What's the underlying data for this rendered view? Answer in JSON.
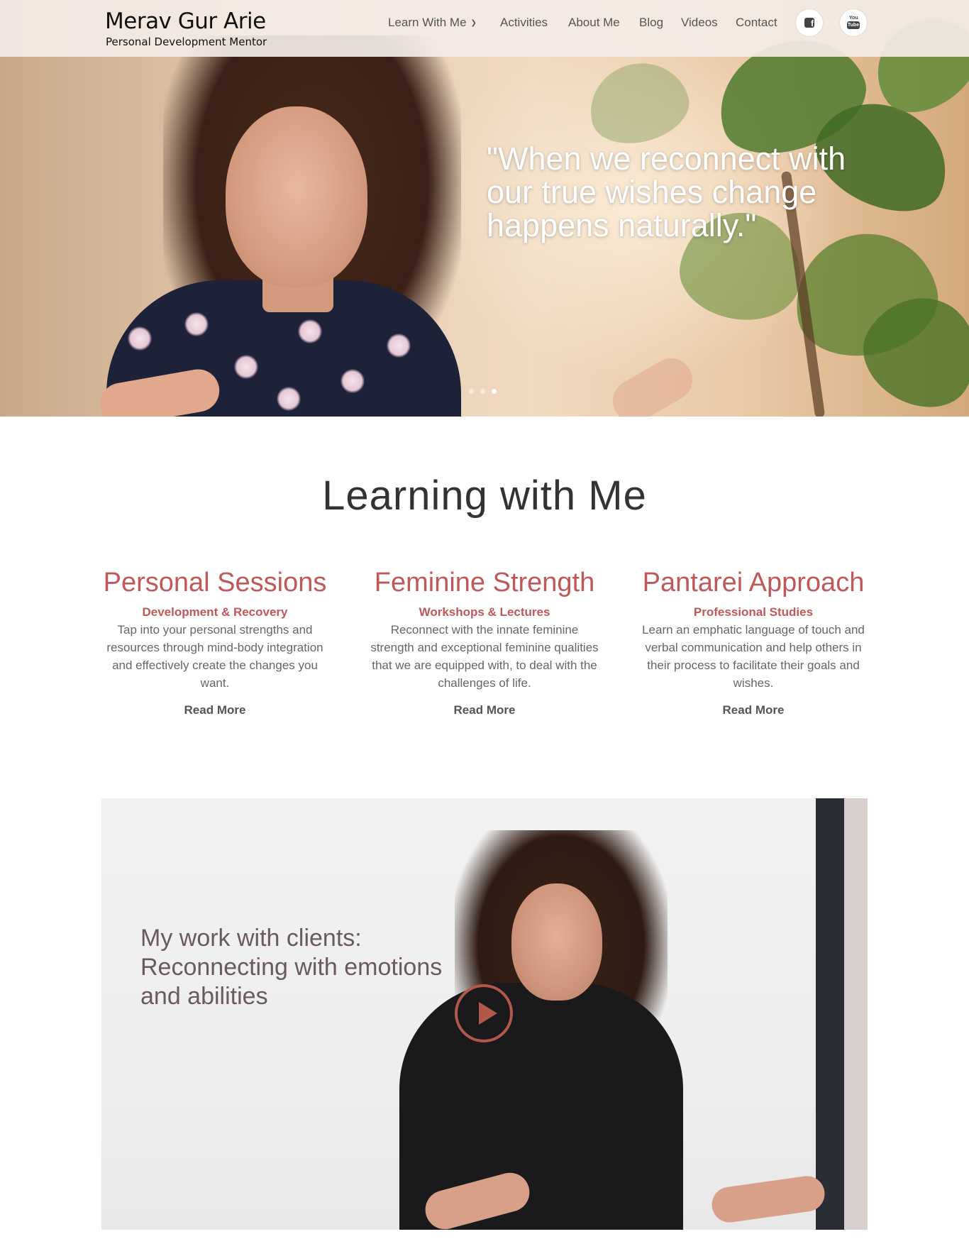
{
  "header": {
    "title": "Merav Gur Arie",
    "subtitle": "Personal Development Mentor",
    "nav": [
      {
        "label": "Learn With Me",
        "has_dropdown": true
      },
      {
        "label": "Activities"
      },
      {
        "label": "About Me"
      },
      {
        "label": "Blog"
      },
      {
        "label": "Videos"
      },
      {
        "label": "Contact"
      }
    ],
    "social": [
      {
        "icon": "facebook-icon",
        "glyph": "f"
      },
      {
        "icon": "youtube-icon",
        "top": "You",
        "bottom": "Tube"
      }
    ]
  },
  "hero": {
    "quote": "\"When we reconnect with our true wishes change happens naturally.\"",
    "slides_count": 3,
    "active_slide": 3
  },
  "learning": {
    "title": "Learning with Me",
    "cards": [
      {
        "title": "Personal Sessions",
        "subtitle": "Development & Recovery",
        "text": "Tap into your personal strengths and resources through mind-body integration and effectively create the changes you want.",
        "link": "Read More"
      },
      {
        "title": "Feminine Strength",
        "subtitle": "Workshops & Lectures",
        "text": "Reconnect with the innate feminine strength and exceptional feminine qualities that we are equipped with, to deal with the challenges of life.",
        "link": "Read More"
      },
      {
        "title": "Pantarei Approach",
        "subtitle": "Professional Studies",
        "text": "Learn an emphatic language of touch and verbal communication and help others in their process to facilitate their goals and wishes.",
        "link": "Read More"
      }
    ]
  },
  "video": {
    "caption": "My work with clients: Reconnecting with emotions and abilities"
  },
  "colors": {
    "accent": "#c0585a",
    "play_button": "#b2584a",
    "header_bg": "#f4ece6"
  }
}
